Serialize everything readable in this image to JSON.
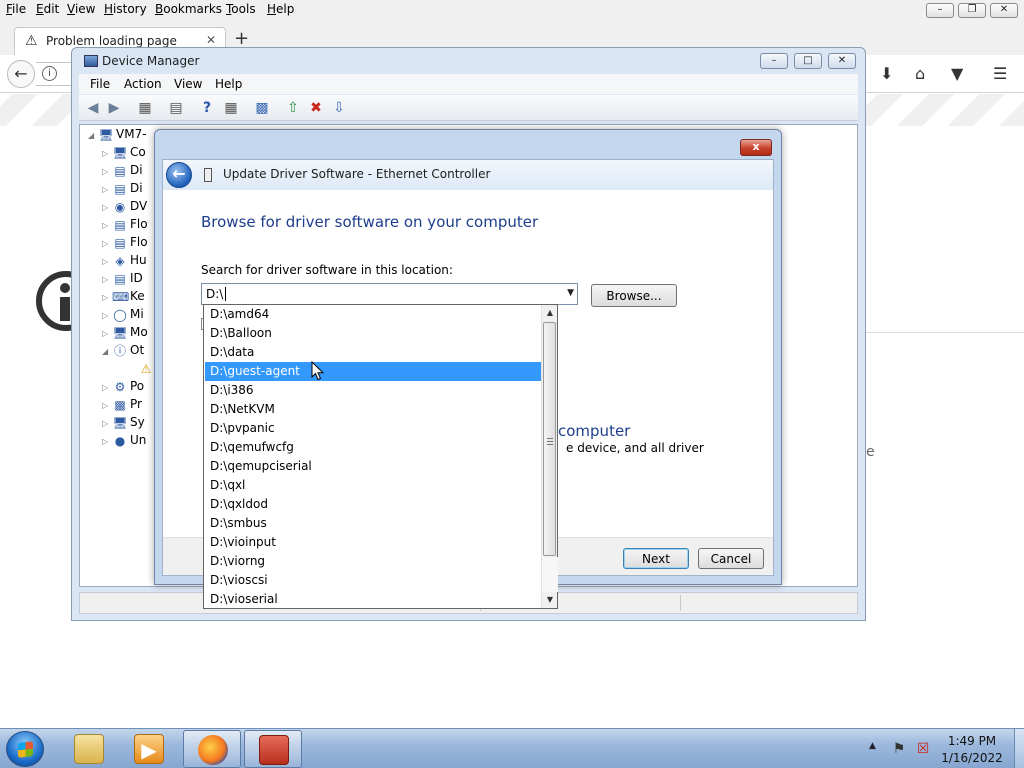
{
  "firefox": {
    "menu": [
      "File",
      "Edit",
      "View",
      "History",
      "Bookmarks",
      "Tools",
      "Help"
    ],
    "tab_title": "Problem loading page",
    "new_tab_label": "+",
    "partial_text_right": "e"
  },
  "device_manager": {
    "title": "Device Manager",
    "menu": [
      "File",
      "Action",
      "View",
      "Help"
    ],
    "tree": {
      "root_label": "VM7-",
      "nodes": [
        "Co",
        "Di",
        "Di",
        "DV",
        "Flo",
        "Flo",
        "Hu",
        "ID",
        "Ke",
        "Mi",
        "Mo",
        "Ot",
        "",
        "Po",
        "Pr",
        "Sy",
        "Un"
      ]
    }
  },
  "update_driver": {
    "title": "Update Driver Software - Ethernet Controller",
    "heading": "Browse for driver software on your computer",
    "search_label": "Search for driver software in this location:",
    "path_value": "D:\\",
    "browse_label": "Browse...",
    "option_title_visible": "computer",
    "option_desc_visible": "e device, and all driver",
    "next_label": "Next",
    "cancel_label": "Cancel",
    "close_label": "x"
  },
  "dropdown": {
    "items": [
      "D:\\amd64",
      "D:\\Balloon",
      "D:\\data",
      "D:\\guest-agent",
      "D:\\i386",
      "D:\\NetKVM",
      "D:\\pvpanic",
      "D:\\qemufwcfg",
      "D:\\qemupciserial",
      "D:\\qxl",
      "D:\\qxldod",
      "D:\\smbus",
      "D:\\vioinput",
      "D:\\viorng",
      "D:\\vioscsi",
      "D:\\vioserial"
    ],
    "selected_index": 3
  },
  "taskbar": {
    "time": "1:49 PM",
    "date": "1/16/2022"
  },
  "colors": {
    "selection": "#3399ff",
    "heading_blue": "#1e3e8c",
    "close_red": "#c7402a"
  }
}
